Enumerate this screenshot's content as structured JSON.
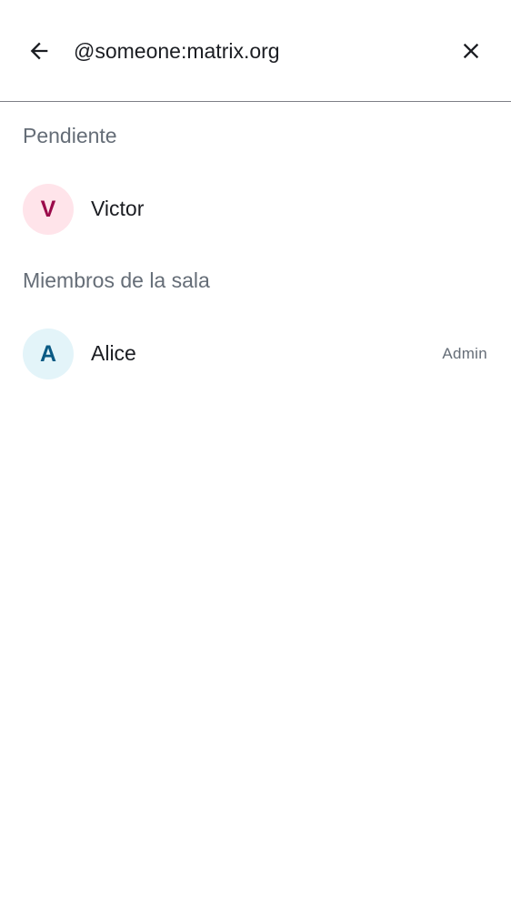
{
  "search": {
    "value": "@someone:matrix.org",
    "back_icon": "arrow-back-icon",
    "clear_icon": "close-icon"
  },
  "sections": {
    "pending": {
      "title": "Pendiente",
      "members": [
        {
          "initial": "V",
          "name": "Victor",
          "avatar_bg": "#ffe4ea",
          "avatar_fg": "#9b0a4a"
        }
      ]
    },
    "room_members": {
      "title": "Miembros de la sala",
      "members": [
        {
          "initial": "A",
          "name": "Alice",
          "role": "Admin",
          "avatar_bg": "#e3f4f9",
          "avatar_fg": "#0a5a84"
        }
      ]
    }
  },
  "colors": {
    "text_primary": "#1b1d22",
    "text_secondary": "#656d77",
    "divider": "#7d7f86"
  }
}
